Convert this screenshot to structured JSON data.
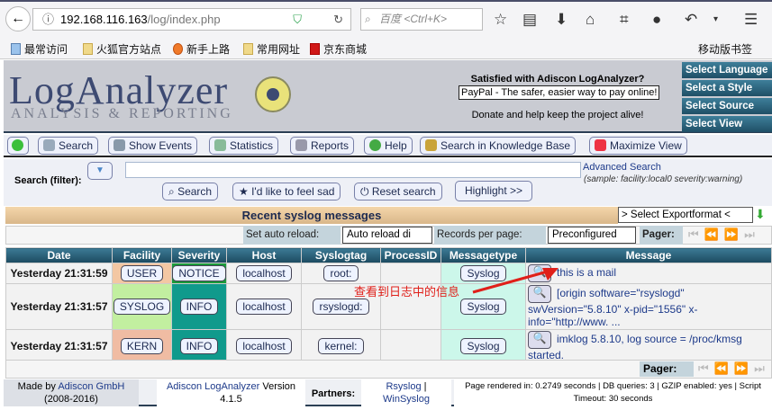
{
  "browser": {
    "url_host": "192.168.116.163",
    "url_path": "/log/index.php",
    "search_placeholder": "百度 <Ctrl+K>"
  },
  "bookmarks": [
    "最常访问",
    "火狐官方站点",
    "新手上路",
    "常用网址",
    "京东商城"
  ],
  "mobile_bookmarks": "移动版书签",
  "header": {
    "logo": "LogAnalyzer",
    "logo_sub": "ANALYSIS & REPORTING",
    "donate_q": "Satisfied with Adiscon LogAnalyzer?",
    "paypal": "PayPal - The safer, easier way to pay online!",
    "donate": "Donate and help keep the project alive!",
    "side": [
      "Select Language",
      "Select a Style",
      "Select Source",
      "Select View"
    ]
  },
  "nav": [
    "Search",
    "Show Events",
    "Statistics",
    "Reports",
    "Help",
    "Search in Knowledge Base",
    "Maximize View"
  ],
  "search": {
    "label": "Search (filter):",
    "value": "",
    "adv": "Advanced Search",
    "sample": "(sample: facility:local0 severity:warning)",
    "buttons": [
      "Search",
      "I'd like to feel sad",
      "Reset search",
      "Highlight >>"
    ]
  },
  "title": "Recent syslog messages",
  "export": "> Select Exportformat <",
  "controls": {
    "auto_label": "Set auto reload:",
    "auto_value": "Auto reload di",
    "rpp_label": "Records per page:",
    "rpp_value": "Preconfigured",
    "pager": "Pager:"
  },
  "columns": [
    "Date",
    "Facility",
    "Severity",
    "Host",
    "Syslogtag",
    "ProcessID",
    "Messagetype",
    "Message"
  ],
  "rows": [
    {
      "date": "Yesterday 21:31:59",
      "facility": "USER",
      "severity": "NOTICE",
      "host": "localhost",
      "tag": "root:",
      "pid": "",
      "type": "Syslog",
      "msg": "this is a mail"
    },
    {
      "date": "Yesterday 21:31:57",
      "facility": "SYSLOG",
      "severity": "INFO",
      "host": "localhost",
      "tag": "rsyslogd:",
      "pid": "",
      "type": "Syslog",
      "msg": "[origin software=\"rsyslogd\" swVersion=\"5.8.10\" x-pid=\"1556\" x-info=\"http://www. ..."
    },
    {
      "date": "Yesterday 21:31:57",
      "facility": "KERN",
      "severity": "INFO",
      "host": "localhost",
      "tag": "kernel:",
      "pid": "",
      "type": "Syslog",
      "msg": "imklog 5.8.10, log source = /proc/kmsg started."
    }
  ],
  "annotation": "查看到日志中的信息",
  "footer": {
    "made_by": "Made by",
    "company": "Adiscon GmbH",
    "years": "(2008-2016)",
    "product": "Adiscon LogAnalyzer",
    "version_label": "Version",
    "version": "4.1.5",
    "partners": "Partners:",
    "p1": "Rsyslog",
    "p2": "WinSyslog",
    "stats1": "Page rendered in: 0.2749 seconds | DB queries: 3 | GZIP enabled: yes | Script",
    "stats2": "Timeout: 30 seconds"
  },
  "colors": {
    "facility_user": "#f3c7a3",
    "facility_syslog": "#c2efa0",
    "facility_kern": "#f0bca3",
    "severity_notice": "#1a9c3a",
    "severity_info": "#109a8c",
    "msgtype": "#ccf7ea"
  }
}
